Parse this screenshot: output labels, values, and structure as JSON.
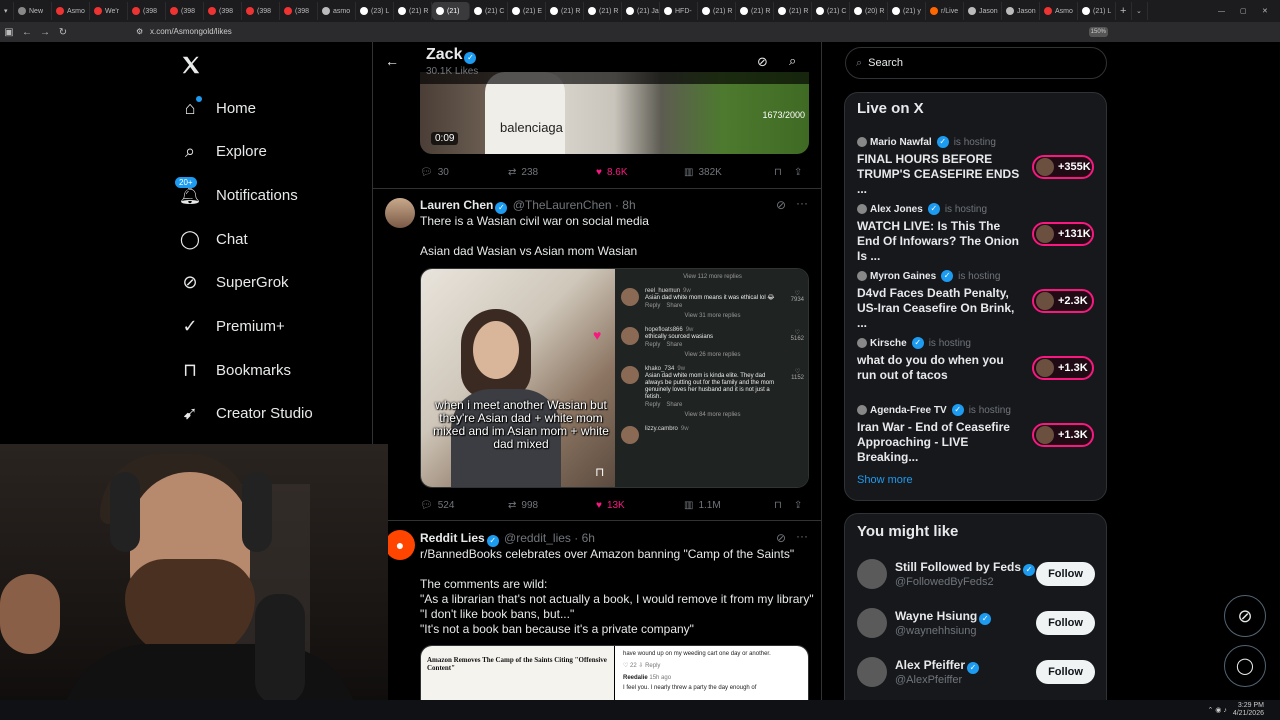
{
  "browser": {
    "tabs": [
      {
        "label": "New",
        "color": "#888"
      },
      {
        "label": "Asmo",
        "color": "#e33"
      },
      {
        "label": "We'r",
        "color": "#e33"
      },
      {
        "label": "(398",
        "color": "#e33"
      },
      {
        "label": "(398",
        "color": "#e33"
      },
      {
        "label": "(398",
        "color": "#e33"
      },
      {
        "label": "(398",
        "color": "#e33"
      },
      {
        "label": "(398",
        "color": "#e33"
      },
      {
        "label": "asmo",
        "color": "#bbb"
      },
      {
        "label": "(23) L",
        "color": "#fff"
      },
      {
        "label": "(21) R",
        "color": "#fff"
      },
      {
        "label": "(21)",
        "color": "#fff",
        "active": true
      },
      {
        "label": "(21) C",
        "color": "#fff"
      },
      {
        "label": "(21) E",
        "color": "#fff"
      },
      {
        "label": "(21) R",
        "color": "#fff"
      },
      {
        "label": "(21) R",
        "color": "#fff"
      },
      {
        "label": "(21) Ja",
        "color": "#fff"
      },
      {
        "label": "HFD-",
        "color": "#fff"
      },
      {
        "label": "(21) R",
        "color": "#fff"
      },
      {
        "label": "(21) R",
        "color": "#fff"
      },
      {
        "label": "(21) R",
        "color": "#fff"
      },
      {
        "label": "(21) C",
        "color": "#fff"
      },
      {
        "label": "(20) R",
        "color": "#fff"
      },
      {
        "label": "(21) y",
        "color": "#fff"
      },
      {
        "label": "r/Live",
        "color": "#f60"
      },
      {
        "label": "Jason",
        "color": "#bbb"
      },
      {
        "label": "Jason",
        "color": "#bbb"
      },
      {
        "label": "Asmo",
        "color": "#e33"
      },
      {
        "label": "(21) L",
        "color": "#fff"
      }
    ],
    "url": "x.com/Asmongold/likes",
    "zoom": "150%"
  },
  "sidebar": {
    "items": [
      {
        "label": "Home",
        "icon": "home-icon"
      },
      {
        "label": "Explore",
        "icon": "search-icon"
      },
      {
        "label": "Notifications",
        "icon": "bell-icon",
        "badge": "20+"
      },
      {
        "label": "Chat",
        "icon": "chat-icon"
      },
      {
        "label": "SuperGrok",
        "icon": "grok-icon"
      },
      {
        "label": "Premium+",
        "icon": "premium-icon"
      },
      {
        "label": "Bookmarks",
        "icon": "bookmark-icon"
      },
      {
        "label": "Creator Studio",
        "icon": "rocket-icon"
      }
    ]
  },
  "header": {
    "name": "Zack",
    "sub": "30.1K Likes"
  },
  "video": {
    "time": "0:09",
    "counter": "1673/2000",
    "watermark": "balenciaga"
  },
  "tweets": [
    {
      "actions": {
        "replies": "30",
        "reposts": "238",
        "likes": "8.6K",
        "views": "382K"
      }
    },
    {
      "name": "Lauren Chen",
      "handle": "@TheLaurenChen",
      "time": "· 8h",
      "text1": "There is a Wasian civil war on social media",
      "text2": "Asian dad Wasian vs Asian mom Wasian",
      "media_caption": "when i meet another Wasian but they're Asian dad + white mom mixed and im Asian mom + white dad mixed",
      "comments": {
        "view_more_top": "View 112 more replies",
        "items": [
          {
            "user": "reel_huemun",
            "age": "9w",
            "text": "Asian dad white mom means it was ethical lol 😂",
            "likes": "7934",
            "reply": "Reply",
            "share": "Share",
            "more": "View 31 more replies"
          },
          {
            "user": "hopefloats866",
            "age": "9w",
            "text": "ethically sourced wasians",
            "likes": "5162",
            "reply": "Reply",
            "share": "Share",
            "more": "View 26 more replies"
          },
          {
            "user": "khako_734",
            "age": "9w",
            "text": "Asian dad white mom is kinda elite. They dad always be putting out for the family and the mom genuinely loves her husband and it is not just a fetish.",
            "likes": "1152",
            "reply": "Reply",
            "share": "Share",
            "more": "View 84 more replies"
          },
          {
            "user": "lizzy.cambro",
            "age": "9w",
            "text": "",
            "likes": "",
            "reply": "",
            "share": "",
            "more": ""
          }
        ]
      },
      "actions": {
        "replies": "524",
        "reposts": "998",
        "likes": "13K",
        "views": "1.1M"
      }
    },
    {
      "name": "Reddit Lies",
      "handle": "@reddit_lies",
      "time": "· 6h",
      "text1": "r/BannedBooks celebrates over Amazon banning \"Camp of the Saints\"",
      "text2": "The comments are wild:",
      "quotes": [
        "\"As a librarian that's not actually a book, I would remove it from my library\"",
        "\"I don't like book bans, but...\"",
        "\"It's not a book ban because it's a private company\""
      ],
      "media_headline": "Amazon Removes The Camp of the Saints Citing \"Offensive Content\"",
      "media_right_text": "have wound up on my weeding cart one day or another.",
      "media_right_user": "Reedalie",
      "media_right_age": "15h ago",
      "media_right_body": "I feel you. I nearly threw a party the day enough of"
    }
  ],
  "search": {
    "placeholder": "Search"
  },
  "live": {
    "title": "Live on X",
    "items": [
      {
        "host": "Mario Nawfal",
        "status": "is hosting",
        "title": "FINAL HOURS BEFORE TRUMP'S CEASEFIRE ENDS ...",
        "count": "+355K"
      },
      {
        "host": "Alex Jones",
        "status": "is hosting",
        "title": "WATCH LIVE: Is This The End Of Infowars? The Onion Is ...",
        "count": "+131K"
      },
      {
        "host": "Myron Gaines",
        "status": "is hosting",
        "title": "D4vd Faces Death Penalty, US-Iran Ceasefire On Brink, ...",
        "count": "+2.3K"
      },
      {
        "host": "Kirsche",
        "status": "is hosting",
        "title": "what do you do when you run out of tacos",
        "count": "+1.3K"
      },
      {
        "host": "Agenda-Free TV",
        "status": "is hosting",
        "title": "Iran War - End of Ceasefire Approaching - LIVE Breaking...",
        "count": "+1.3K"
      }
    ],
    "show_more": "Show more"
  },
  "suggest": {
    "title": "You might like",
    "items": [
      {
        "name": "Still Followed by Feds",
        "handle": "@FollowedByFeds2",
        "button": "Follow"
      },
      {
        "name": "Wayne Hsiung",
        "handle": "@waynehhsiung",
        "button": "Follow"
      },
      {
        "name": "Alex Pfeiffer",
        "handle": "@AlexPfeiffer",
        "button": "Follow"
      }
    ]
  },
  "taskbar": {
    "time": "3:29 PM",
    "date": "4/21/2026"
  }
}
